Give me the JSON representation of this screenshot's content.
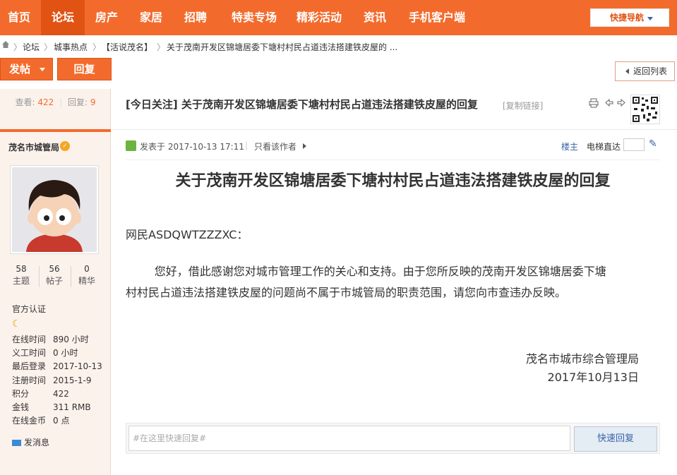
{
  "nav": {
    "items": [
      "首页",
      "论坛",
      "房产",
      "家居",
      "招聘",
      "特卖专场",
      "精彩活动",
      "资讯",
      "手机客户端"
    ],
    "quick_nav": "快捷导航"
  },
  "breadcrumb": [
    "论坛",
    "城事热点",
    "【活说茂名】",
    "关于茂南开发区锦塘居委下塘村村民占道违法搭建铁皮屋的 ..."
  ],
  "actions": {
    "post": "发帖",
    "reply": "回复",
    "back": "返回列表"
  },
  "sidebar": {
    "views_label": "查看:",
    "views": "422",
    "replies_label": "回复:",
    "replies": "9",
    "author": "茂名市城管局",
    "stats": [
      {
        "value": "58",
        "label": "主题"
      },
      {
        "value": "56",
        "label": "帖子"
      },
      {
        "value": "0",
        "label": "精华"
      }
    ],
    "cert": "官方认证",
    "info": [
      {
        "k": "在线时间",
        "v": "890 小时"
      },
      {
        "k": "义工时间",
        "v": "0 小时"
      },
      {
        "k": "最后登录",
        "v": "2017-10-13"
      },
      {
        "k": "注册时间",
        "v": "2015-1-9"
      },
      {
        "k": "积分",
        "v": "422"
      },
      {
        "k": "金钱",
        "v": "311 RMB"
      },
      {
        "k": "在线金币",
        "v": "0 点"
      }
    ],
    "message": "发消息"
  },
  "thread": {
    "title": "[今日关注] 关于茂南开发区锦塘居委下塘村村民占道违法搭建铁皮屋的回复",
    "copy_link": "[复制链接]",
    "posted": "发表于 2017-10-13 17:11",
    "only_author": "只看该作者",
    "floor": "楼主",
    "elevator": "电梯直达"
  },
  "post": {
    "title": "关于茂南开发区锦塘居委下塘村村民占道违法搭建铁皮屋的回复",
    "greeting": "网民ASDQWTZZZXC：",
    "line1": "        您好，借此感谢您对城市管理工作的关心和支持。由于您所反映的茂南开发区锦塘居委下塘",
    "line2": "村村民占道违法搭建铁皮屋的问题尚不属于市城管局的职责范围，请您向市查违办反映。",
    "signer": "茂名市城市综合管理局",
    "date": "2017年10月13日"
  },
  "reply_box": {
    "placeholder": "#在这里快速回复#",
    "button": "快速回复"
  }
}
